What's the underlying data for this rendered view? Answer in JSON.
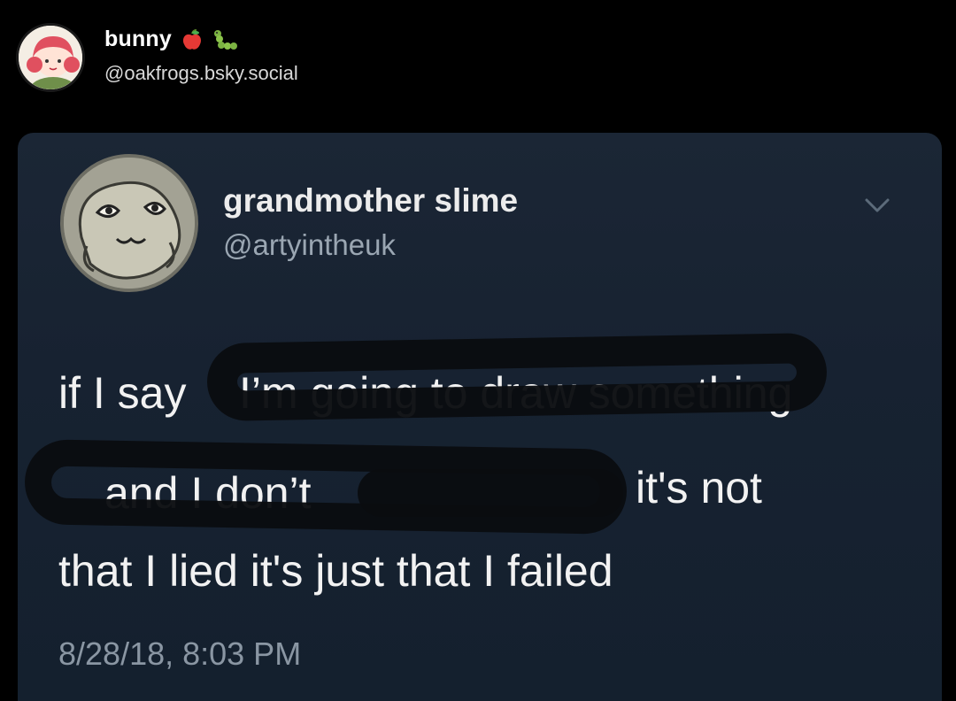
{
  "post": {
    "author_name": "bunny",
    "author_handle": "@oakfrogs.bsky.social",
    "emojis": [
      "apple-icon",
      "caterpillar-icon"
    ]
  },
  "tweet": {
    "author_name": "grandmother slime",
    "author_handle": "@artyintheuk",
    "line1_lead": "if I say",
    "line1_tail": "I’m going to draw something",
    "line2_lead": "and I don’t",
    "line2_tail": "it's not",
    "line3": "that I lied it's just that I failed",
    "timestamp": "8/28/18, 8:03 PM"
  },
  "colors": {
    "background": "#000000",
    "card": "#172231",
    "handle": "#9aa6b2",
    "timestamp": "#8a96a3",
    "scribble": "#0a0c10"
  }
}
